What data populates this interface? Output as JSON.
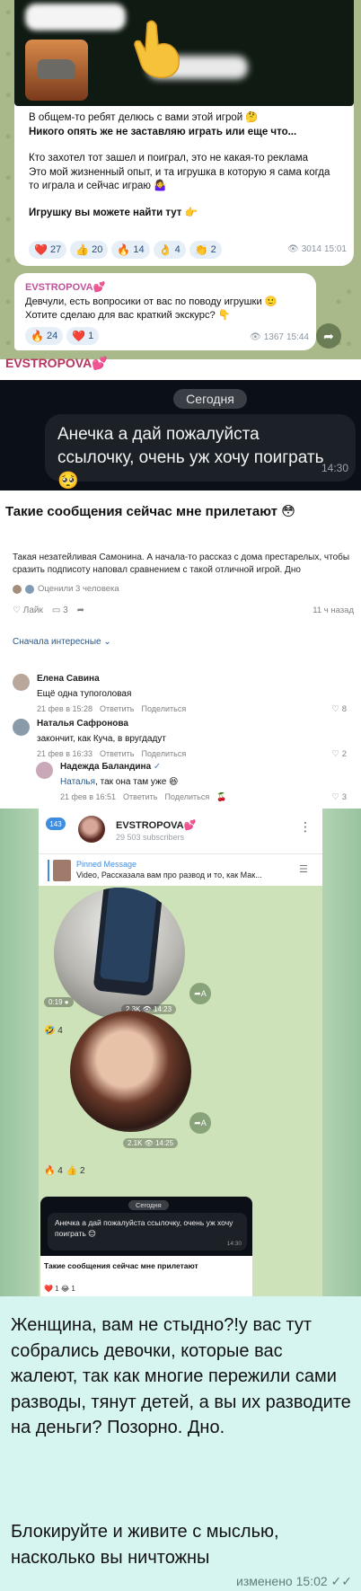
{
  "tg_post": {
    "line1": "В общем-то ребят делюсь с вами этой игрой 🤔",
    "line2": "Никого опять же не заставляю играть или еще что...",
    "line3": "Кто захотел тот зашел и поиграл, это не какая-то реклама",
    "line4": "Это мой жизненный опыт, и та игрушка в которую я сама когда",
    "line5": "то играла и сейчас играю 🤷‍♀️",
    "line6": "Игрушку вы можете найти тут 👉",
    "reactions": [
      {
        "icon": "❤️",
        "count": "27"
      },
      {
        "icon": "👍",
        "count": "20"
      },
      {
        "icon": "🔥",
        "count": "14"
      },
      {
        "icon": "👌",
        "count": "4"
      },
      {
        "icon": "👏",
        "count": "2"
      }
    ],
    "views": "3014",
    "time": "15:01"
  },
  "tg_forward": {
    "name": "EVSTROPOVA💕",
    "line1": "Девчули, есть вопросики от вас по поводу игрушки 🙂",
    "line2": "Хотите сделаю для вас краткий экскурс? 👇",
    "reactions": [
      {
        "icon": "🔥",
        "count": "24"
      },
      {
        "icon": "❤️",
        "count": "1"
      }
    ],
    "views": "1367",
    "time": "15:44"
  },
  "author_label": "EVSTROPOVA💕",
  "dark_chat": {
    "date": "Сегодня",
    "message": "Анечка а дай пожалуйста ссылочку, очень уж хочу поиграть 🥺",
    "time": "14:30"
  },
  "caption": "Такие сообщения сейчас мне прилетают 😳",
  "vk": {
    "post": "Такая незатейливая Самонина. А начала-то рассказ с дома престарелых, чтобы сразить подписоту наповал сравнением с такой отличной игрой. Дно",
    "rated": "Оценили 3 человека",
    "like": "Лайк",
    "comments_count": "3",
    "ago": "11 ч назад",
    "sort": "Сначала интересные",
    "comments": [
      {
        "name": "Елена Савина",
        "text": "Ещё одна тупоголовая",
        "date": "21 фев в 15:28",
        "reply": "Ответить",
        "share": "Поделиться",
        "likes": "8"
      },
      {
        "name": "Наталья Сафронова",
        "text": "закончит, как Куча, в вругдадут",
        "date": "21 фев в 16:33",
        "reply": "Ответить",
        "share": "Поделиться",
        "likes": "2"
      },
      {
        "name": "Надежда Баландина",
        "mention": "Наталья",
        "text": ", так она там уже 😆",
        "date": "21 фев в 16:51",
        "reply": "Ответить",
        "share": "Поделиться",
        "likes": "3"
      }
    ]
  },
  "phone": {
    "badge": "143",
    "channel": "EVSTROPOVA💕",
    "subscribers": "29 503 subscribers",
    "pinned_title": "Pinned Message",
    "pinned_text": "Video, Рассказала вам про развод и то, как Мак...",
    "video1_meta": "2.3K 👁 14:23",
    "video1_rx": "🤣 4",
    "video2_dur": "0:19 ●",
    "video2_meta": "2.1K 👁 14:25",
    "video2_rx1": "🔥 4",
    "video2_rx2": "👍 2",
    "mini_date": "Сегодня",
    "mini_msg": "Анечка а дай пожалуйста ссылочку, очень уж хочу поиграть 😊",
    "mini_time": "14:30",
    "mini_caption": "Такие сообщения сейчас мне прилетают",
    "mini_rx": "❤️ 1   😂 1"
  },
  "note": {
    "text": "Женщина, вам не стыдно?!у вас тут собрались девочки, которые вас жалеют, так как многие пережили сами разводы, тянут детей, а вы их разводите на деньги? Позорно.  Дно.",
    "text2": "Блокируйте и живите с мыслью, насколько вы ничтожны",
    "edited": "изменено 15:02 ✓✓"
  }
}
